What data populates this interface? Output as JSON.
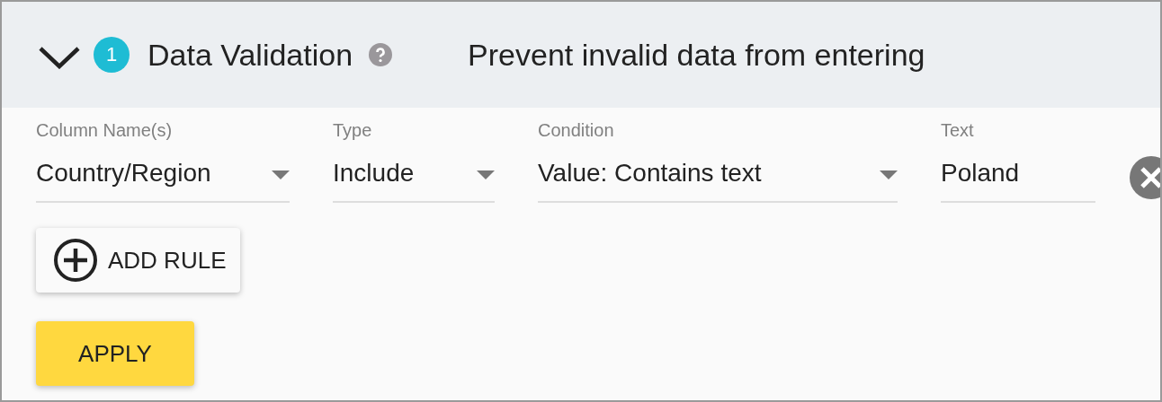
{
  "panel": {
    "expanded": true,
    "step": "1",
    "title": "Data Validation",
    "subtitle": "Prevent invalid data from entering"
  },
  "rule": {
    "fields": [
      {
        "kind": "dropdown",
        "label": "Column Name(s)",
        "value": "Country/Region"
      },
      {
        "kind": "dropdown",
        "label": "Type",
        "value": "Include"
      },
      {
        "kind": "dropdown",
        "label": "Condition",
        "value": "Value: Contains text"
      },
      {
        "kind": "text",
        "label": "Text",
        "value": "Poland"
      }
    ]
  },
  "buttons": {
    "add_rule": "ADD RULE",
    "apply": "APPLY"
  }
}
